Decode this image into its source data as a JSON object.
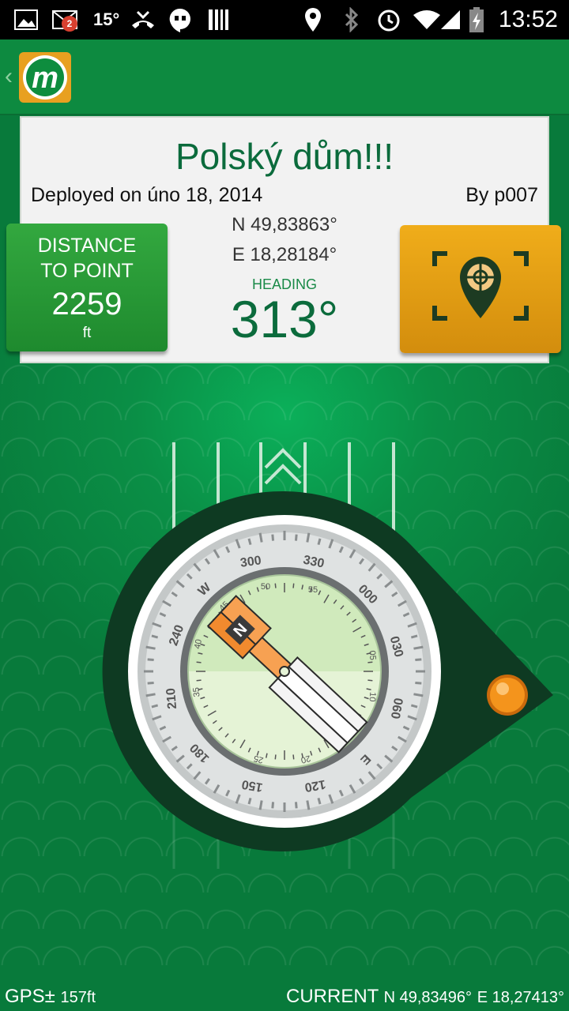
{
  "status_bar": {
    "notification_count": "2",
    "temperature": "15°",
    "time": "13:52"
  },
  "app": {
    "logo_letter": "m"
  },
  "cache": {
    "title": "Polský dům!!!",
    "deployed": "Deployed on úno 18, 2014",
    "by": "By p007",
    "lat": "N 49,83863°",
    "lon": "E 18,28184°",
    "heading_label": "HEADING",
    "heading_value": "313°"
  },
  "distance": {
    "label_line1": "DISTANCE",
    "label_line2": "TO POINT",
    "value": "2259",
    "unit": "ft"
  },
  "compass": {
    "outer_ticks": [
      "300",
      "330",
      "000",
      "030",
      "060",
      "090",
      "120",
      "150",
      "180",
      "210",
      "240",
      "W",
      "E"
    ],
    "inner_ticks": [
      "50",
      "55",
      "05",
      "10",
      "15",
      "20",
      "25",
      "30",
      "35",
      "40",
      "45"
    ],
    "needle_letter": "N"
  },
  "footer": {
    "gps_label": "GPS±",
    "gps_value": "157ft",
    "current_label": "CURRENT",
    "current_lat": "N 49,83496°",
    "current_lon": "E 18,27413°"
  },
  "colors": {
    "brand_green": "#0b6b3c",
    "accent_orange": "#f0ad1a",
    "distance_green": "#2a9e3a"
  }
}
